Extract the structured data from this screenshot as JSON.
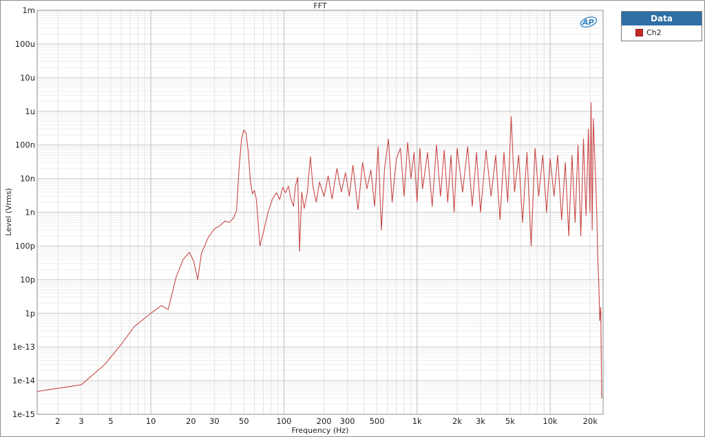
{
  "chart_data": {
    "type": "line",
    "title": "FFT",
    "xlabel": "Frequency (Hz)",
    "ylabel": "Level (Vrms)",
    "x_scale": "log",
    "y_scale": "log",
    "xlim": [
      1.4,
      25000
    ],
    "ylim": [
      1e-15,
      0.001
    ],
    "grid": true,
    "x_ticks": [
      {
        "value": 2,
        "label": "2"
      },
      {
        "value": 3,
        "label": "3"
      },
      {
        "value": 5,
        "label": "5"
      },
      {
        "value": 10,
        "label": "10"
      },
      {
        "value": 20,
        "label": "20"
      },
      {
        "value": 30,
        "label": "30"
      },
      {
        "value": 50,
        "label": "50"
      },
      {
        "value": 100,
        "label": "100"
      },
      {
        "value": 200,
        "label": "200"
      },
      {
        "value": 300,
        "label": "300"
      },
      {
        "value": 500,
        "label": "500"
      },
      {
        "value": 1000,
        "label": "1k"
      },
      {
        "value": 2000,
        "label": "2k"
      },
      {
        "value": 3000,
        "label": "3k"
      },
      {
        "value": 5000,
        "label": "5k"
      },
      {
        "value": 10000,
        "label": "10k"
      },
      {
        "value": 20000,
        "label": "20k"
      }
    ],
    "y_ticks": [
      {
        "value": 0.001,
        "label": "1m"
      },
      {
        "value": 0.0001,
        "label": "100u"
      },
      {
        "value": 1e-05,
        "label": "10u"
      },
      {
        "value": 1e-06,
        "label": "1u"
      },
      {
        "value": 1e-07,
        "label": "100n"
      },
      {
        "value": 1e-08,
        "label": "10n"
      },
      {
        "value": 1e-09,
        "label": "1n"
      },
      {
        "value": 1e-10,
        "label": "100p"
      },
      {
        "value": 1e-11,
        "label": "10p"
      },
      {
        "value": 1e-12,
        "label": "1p"
      },
      {
        "value": 1e-13,
        "label": "1e-13"
      },
      {
        "value": 1e-14,
        "label": "1e-14"
      },
      {
        "value": 1e-15,
        "label": "1e-15"
      }
    ],
    "legend": {
      "title": "Data",
      "position": "right"
    },
    "series": [
      {
        "name": "Ch2",
        "color": "#c84646",
        "points": [
          [
            1.4,
            4.8e-15
          ],
          [
            3,
            7.5e-15
          ],
          [
            4.5,
            3e-14
          ],
          [
            6,
            1.2e-13
          ],
          [
            7.5,
            4e-13
          ],
          [
            10,
            1e-12
          ],
          [
            12,
            1.7e-12
          ],
          [
            13.5,
            1.3e-12
          ],
          [
            15.5,
            1.2e-11
          ],
          [
            17.5,
            4e-11
          ],
          [
            19.5,
            6.5e-11
          ],
          [
            21,
            3.5e-11
          ],
          [
            22.5,
            1e-11
          ],
          [
            24,
            6e-11
          ],
          [
            27,
            1.8e-10
          ],
          [
            30,
            3.2e-10
          ],
          [
            33,
            4e-10
          ],
          [
            36,
            5.5e-10
          ],
          [
            39,
            5e-10
          ],
          [
            42,
            7e-10
          ],
          [
            44,
            1.1e-09
          ],
          [
            46,
            2e-08
          ],
          [
            48,
            1.5e-07
          ],
          [
            50,
            2.8e-07
          ],
          [
            52,
            2.2e-07
          ],
          [
            54,
            6e-08
          ],
          [
            56,
            8e-09
          ],
          [
            58,
            3.5e-09
          ],
          [
            60,
            4.5e-09
          ],
          [
            62,
            2.5e-09
          ],
          [
            66,
            1e-10
          ],
          [
            70,
            2.5e-10
          ],
          [
            76,
            1e-09
          ],
          [
            82,
            2.5e-09
          ],
          [
            88,
            3.8e-09
          ],
          [
            93,
            2.4e-09
          ],
          [
            98,
            5.5e-09
          ],
          [
            103,
            3.8e-09
          ],
          [
            108,
            6e-09
          ],
          [
            113,
            2.5e-09
          ],
          [
            118,
            1.5e-09
          ],
          [
            122,
            6e-09
          ],
          [
            127,
            1.1e-08
          ],
          [
            131,
            7e-11
          ],
          [
            136,
            4e-09
          ],
          [
            142,
            1.3e-09
          ],
          [
            150,
            4e-09
          ],
          [
            158,
            4.5e-08
          ],
          [
            165,
            6e-09
          ],
          [
            175,
            2e-09
          ],
          [
            185,
            8e-09
          ],
          [
            200,
            3e-09
          ],
          [
            215,
            1.2e-08
          ],
          [
            230,
            2.5e-09
          ],
          [
            250,
            2e-08
          ],
          [
            270,
            4e-09
          ],
          [
            290,
            1.5e-08
          ],
          [
            310,
            3e-09
          ],
          [
            330,
            2.5e-08
          ],
          [
            360,
            1.2e-09
          ],
          [
            390,
            3e-08
          ],
          [
            420,
            5e-09
          ],
          [
            450,
            1.8e-08
          ],
          [
            480,
            1.5e-09
          ],
          [
            510,
            9e-08
          ],
          [
            540,
            3e-10
          ],
          [
            570,
            2e-08
          ],
          [
            610,
            1.5e-07
          ],
          [
            650,
            2e-09
          ],
          [
            700,
            4e-08
          ],
          [
            750,
            8e-08
          ],
          [
            800,
            3e-09
          ],
          [
            850,
            1.2e-07
          ],
          [
            900,
            1e-08
          ],
          [
            950,
            6e-08
          ],
          [
            1000,
            2e-09
          ],
          [
            1050,
            8e-08
          ],
          [
            1100,
            5e-09
          ],
          [
            1200,
            6e-08
          ],
          [
            1300,
            1.5e-09
          ],
          [
            1400,
            1e-07
          ],
          [
            1500,
            3e-09
          ],
          [
            1600,
            7e-08
          ],
          [
            1700,
            2e-09
          ],
          [
            1800,
            5e-08
          ],
          [
            1900,
            1e-09
          ],
          [
            2000,
            8e-08
          ],
          [
            2200,
            4e-09
          ],
          [
            2400,
            9e-08
          ],
          [
            2600,
            1.5e-09
          ],
          [
            2800,
            6e-08
          ],
          [
            3000,
            1e-09
          ],
          [
            3300,
            7e-08
          ],
          [
            3600,
            3e-09
          ],
          [
            3900,
            5e-08
          ],
          [
            4200,
            6e-10
          ],
          [
            4500,
            6e-08
          ],
          [
            4800,
            2e-09
          ],
          [
            5100,
            7e-07
          ],
          [
            5400,
            4e-09
          ],
          [
            5800,
            5e-08
          ],
          [
            6200,
            5e-10
          ],
          [
            6700,
            6e-08
          ],
          [
            7200,
            1e-10
          ],
          [
            7700,
            8e-08
          ],
          [
            8200,
            3e-09
          ],
          [
            8800,
            5e-08
          ],
          [
            9400,
            1e-09
          ],
          [
            10000,
            4e-08
          ],
          [
            10700,
            3e-09
          ],
          [
            11400,
            5e-08
          ],
          [
            12200,
            6e-10
          ],
          [
            13000,
            3e-08
          ],
          [
            13800,
            2e-10
          ],
          [
            14600,
            5e-08
          ],
          [
            15400,
            5e-10
          ],
          [
            16200,
            1e-07
          ],
          [
            17000,
            2e-10
          ],
          [
            17800,
            1.5e-07
          ],
          [
            18600,
            8e-10
          ],
          [
            19400,
            3e-07
          ],
          [
            19900,
            1e-09
          ],
          [
            20300,
            1.8e-06
          ],
          [
            20700,
            3e-10
          ],
          [
            21100,
            6e-07
          ],
          [
            21600,
            5e-08
          ],
          [
            22000,
            8e-09
          ],
          [
            22400,
            1e-09
          ],
          [
            22800,
            4e-11
          ],
          [
            23200,
            8e-12
          ],
          [
            23600,
            6e-13
          ],
          [
            24000,
            1.5e-12
          ],
          [
            24400,
            3e-15
          ]
        ]
      }
    ]
  }
}
